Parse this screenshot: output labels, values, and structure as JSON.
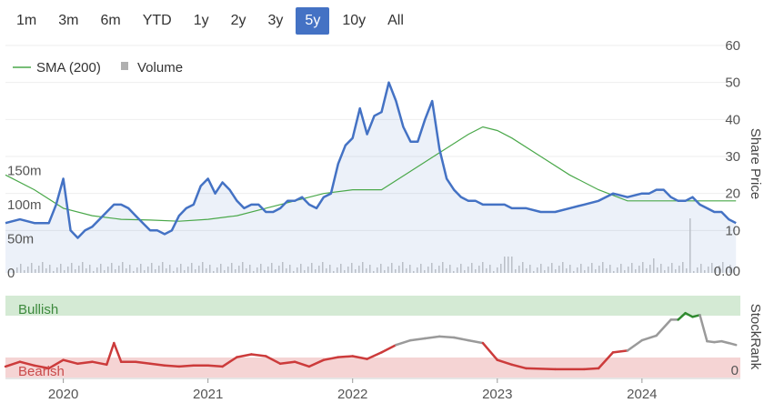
{
  "range_buttons": {
    "items": [
      "1m",
      "3m",
      "6m",
      "YTD",
      "1y",
      "2y",
      "3y",
      "5y",
      "10y",
      "All"
    ],
    "active": "5y"
  },
  "chart_data": {
    "type": "line",
    "legend": {
      "sma_label": "SMA (200)",
      "volume_label": "Volume",
      "sma_color": "#4aa84a",
      "volume_color": "#b0b0b0"
    },
    "price_axis": {
      "title": "Share Price",
      "ticks": [
        "60",
        "50",
        "40",
        "30",
        "20",
        "10"
      ],
      "ylim": [
        0,
        60
      ]
    },
    "volume_axis": {
      "ticks": [
        "150m",
        "100m",
        "50m",
        "0"
      ],
      "ylim": [
        0,
        200
      ]
    },
    "volume_zero_label": "0.00",
    "x_axis": {
      "ticks": [
        "2020",
        "2021",
        "2022",
        "2023",
        "2024"
      ]
    },
    "price_color": "#4472c4",
    "series": [
      {
        "name": "Price",
        "x": [
          2019.6,
          2019.7,
          2019.8,
          2019.9,
          2019.95,
          2020.0,
          2020.05,
          2020.1,
          2020.15,
          2020.2,
          2020.25,
          2020.3,
          2020.35,
          2020.4,
          2020.45,
          2020.5,
          2020.55,
          2020.6,
          2020.65,
          2020.7,
          2020.75,
          2020.8,
          2020.85,
          2020.9,
          2020.95,
          2021.0,
          2021.05,
          2021.1,
          2021.15,
          2021.2,
          2021.25,
          2021.3,
          2021.35,
          2021.4,
          2021.45,
          2021.5,
          2021.55,
          2021.6,
          2021.65,
          2021.7,
          2021.75,
          2021.8,
          2021.85,
          2021.9,
          2021.95,
          2022.0,
          2022.05,
          2022.1,
          2022.15,
          2022.2,
          2022.25,
          2022.3,
          2022.35,
          2022.4,
          2022.45,
          2022.5,
          2022.55,
          2022.6,
          2022.65,
          2022.7,
          2022.75,
          2022.8,
          2022.85,
          2022.9,
          2022.95,
          2023.0,
          2023.05,
          2023.1,
          2023.15,
          2023.2,
          2023.3,
          2023.4,
          2023.5,
          2023.6,
          2023.7,
          2023.8,
          2023.9,
          2024.0,
          2024.05,
          2024.1,
          2024.15,
          2024.2,
          2024.25,
          2024.3,
          2024.35,
          2024.4,
          2024.45,
          2024.5,
          2024.55,
          2024.6,
          2024.65
        ],
        "values": [
          12,
          13,
          12,
          12,
          17,
          24,
          10,
          8,
          10,
          11,
          13,
          15,
          17,
          17,
          16,
          14,
          12,
          10,
          10,
          9,
          10,
          14,
          16,
          17,
          22,
          24,
          20,
          23,
          21,
          18,
          16,
          17,
          17,
          15,
          15,
          16,
          18,
          18,
          19,
          17,
          16,
          19,
          20,
          28,
          33,
          35,
          43,
          36,
          41,
          42,
          50,
          45,
          38,
          34,
          34,
          40,
          45,
          32,
          24,
          21,
          19,
          18,
          18,
          17,
          17,
          17,
          17,
          16,
          16,
          16,
          15,
          15,
          16,
          17,
          18,
          20,
          19,
          20,
          20,
          21,
          21,
          19,
          18,
          18,
          19,
          17,
          16,
          15,
          15,
          13,
          12
        ]
      },
      {
        "name": "SMA (200)",
        "x": [
          2019.6,
          2019.8,
          2020.0,
          2020.2,
          2020.4,
          2020.6,
          2020.8,
          2021.0,
          2021.2,
          2021.4,
          2021.6,
          2021.8,
          2022.0,
          2022.2,
          2022.4,
          2022.6,
          2022.8,
          2022.9,
          2023.0,
          2023.1,
          2023.3,
          2023.5,
          2023.7,
          2023.9,
          2024.1,
          2024.3,
          2024.5,
          2024.65
        ],
        "values": [
          25,
          21,
          16,
          14,
          13,
          12.8,
          12.5,
          13,
          14,
          16,
          18,
          20,
          21,
          21,
          26,
          31,
          36,
          38,
          37,
          35,
          30,
          25,
          21,
          18,
          18,
          18,
          18,
          18
        ]
      }
    ],
    "volume_bars_desc": "thin grey bars along bottom",
    "stockrank": {
      "title": "StockRank",
      "bullish_label": "Bullish",
      "bearish_label": "Bearish",
      "zero_label": "0",
      "x": [
        2019.6,
        2019.7,
        2019.8,
        2019.9,
        2020.0,
        2020.1,
        2020.2,
        2020.3,
        2020.35,
        2020.4,
        2020.5,
        2020.6,
        2020.7,
        2020.8,
        2020.9,
        2021.0,
        2021.1,
        2021.2,
        2021.3,
        2021.4,
        2021.5,
        2021.6,
        2021.7,
        2021.8,
        2021.9,
        2022.0,
        2022.1,
        2022.2,
        2022.3,
        2022.4,
        2022.5,
        2022.6,
        2022.7,
        2022.8,
        2022.9,
        2023.0,
        2023.1,
        2023.2,
        2023.4,
        2023.6,
        2023.7,
        2023.8,
        2023.9,
        2024.0,
        2024.1,
        2024.2,
        2024.25,
        2024.3,
        2024.35,
        2024.4,
        2024.45,
        2024.5,
        2024.55,
        2024.6,
        2024.65
      ],
      "values": [
        5,
        10,
        6,
        3,
        12,
        8,
        10,
        7,
        30,
        10,
        10,
        8,
        6,
        5,
        6,
        6,
        5,
        15,
        18,
        16,
        8,
        10,
        5,
        12,
        15,
        16,
        13,
        20,
        28,
        33,
        35,
        37,
        36,
        33,
        30,
        12,
        7,
        3,
        2,
        2,
        3,
        20,
        22,
        33,
        38,
        55,
        55,
        62,
        58,
        60,
        32,
        31,
        32,
        30,
        28
      ]
    }
  }
}
